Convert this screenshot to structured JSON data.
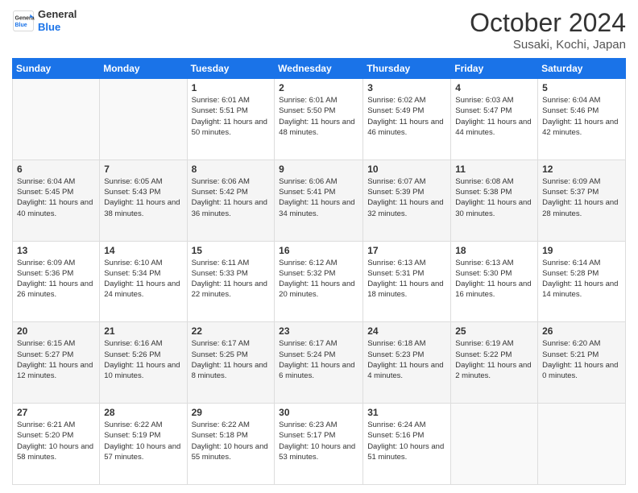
{
  "header": {
    "logo_line1": "General",
    "logo_line2": "Blue",
    "month": "October 2024",
    "location": "Susaki, Kochi, Japan"
  },
  "days_of_week": [
    "Sunday",
    "Monday",
    "Tuesday",
    "Wednesday",
    "Thursday",
    "Friday",
    "Saturday"
  ],
  "weeks": [
    [
      {
        "day": "",
        "sunrise": "",
        "sunset": "",
        "daylight": ""
      },
      {
        "day": "",
        "sunrise": "",
        "sunset": "",
        "daylight": ""
      },
      {
        "day": "1",
        "sunrise": "Sunrise: 6:01 AM",
        "sunset": "Sunset: 5:51 PM",
        "daylight": "Daylight: 11 hours and 50 minutes."
      },
      {
        "day": "2",
        "sunrise": "Sunrise: 6:01 AM",
        "sunset": "Sunset: 5:50 PM",
        "daylight": "Daylight: 11 hours and 48 minutes."
      },
      {
        "day": "3",
        "sunrise": "Sunrise: 6:02 AM",
        "sunset": "Sunset: 5:49 PM",
        "daylight": "Daylight: 11 hours and 46 minutes."
      },
      {
        "day": "4",
        "sunrise": "Sunrise: 6:03 AM",
        "sunset": "Sunset: 5:47 PM",
        "daylight": "Daylight: 11 hours and 44 minutes."
      },
      {
        "day": "5",
        "sunrise": "Sunrise: 6:04 AM",
        "sunset": "Sunset: 5:46 PM",
        "daylight": "Daylight: 11 hours and 42 minutes."
      }
    ],
    [
      {
        "day": "6",
        "sunrise": "Sunrise: 6:04 AM",
        "sunset": "Sunset: 5:45 PM",
        "daylight": "Daylight: 11 hours and 40 minutes."
      },
      {
        "day": "7",
        "sunrise": "Sunrise: 6:05 AM",
        "sunset": "Sunset: 5:43 PM",
        "daylight": "Daylight: 11 hours and 38 minutes."
      },
      {
        "day": "8",
        "sunrise": "Sunrise: 6:06 AM",
        "sunset": "Sunset: 5:42 PM",
        "daylight": "Daylight: 11 hours and 36 minutes."
      },
      {
        "day": "9",
        "sunrise": "Sunrise: 6:06 AM",
        "sunset": "Sunset: 5:41 PM",
        "daylight": "Daylight: 11 hours and 34 minutes."
      },
      {
        "day": "10",
        "sunrise": "Sunrise: 6:07 AM",
        "sunset": "Sunset: 5:39 PM",
        "daylight": "Daylight: 11 hours and 32 minutes."
      },
      {
        "day": "11",
        "sunrise": "Sunrise: 6:08 AM",
        "sunset": "Sunset: 5:38 PM",
        "daylight": "Daylight: 11 hours and 30 minutes."
      },
      {
        "day": "12",
        "sunrise": "Sunrise: 6:09 AM",
        "sunset": "Sunset: 5:37 PM",
        "daylight": "Daylight: 11 hours and 28 minutes."
      }
    ],
    [
      {
        "day": "13",
        "sunrise": "Sunrise: 6:09 AM",
        "sunset": "Sunset: 5:36 PM",
        "daylight": "Daylight: 11 hours and 26 minutes."
      },
      {
        "day": "14",
        "sunrise": "Sunrise: 6:10 AM",
        "sunset": "Sunset: 5:34 PM",
        "daylight": "Daylight: 11 hours and 24 minutes."
      },
      {
        "day": "15",
        "sunrise": "Sunrise: 6:11 AM",
        "sunset": "Sunset: 5:33 PM",
        "daylight": "Daylight: 11 hours and 22 minutes."
      },
      {
        "day": "16",
        "sunrise": "Sunrise: 6:12 AM",
        "sunset": "Sunset: 5:32 PM",
        "daylight": "Daylight: 11 hours and 20 minutes."
      },
      {
        "day": "17",
        "sunrise": "Sunrise: 6:13 AM",
        "sunset": "Sunset: 5:31 PM",
        "daylight": "Daylight: 11 hours and 18 minutes."
      },
      {
        "day": "18",
        "sunrise": "Sunrise: 6:13 AM",
        "sunset": "Sunset: 5:30 PM",
        "daylight": "Daylight: 11 hours and 16 minutes."
      },
      {
        "day": "19",
        "sunrise": "Sunrise: 6:14 AM",
        "sunset": "Sunset: 5:28 PM",
        "daylight": "Daylight: 11 hours and 14 minutes."
      }
    ],
    [
      {
        "day": "20",
        "sunrise": "Sunrise: 6:15 AM",
        "sunset": "Sunset: 5:27 PM",
        "daylight": "Daylight: 11 hours and 12 minutes."
      },
      {
        "day": "21",
        "sunrise": "Sunrise: 6:16 AM",
        "sunset": "Sunset: 5:26 PM",
        "daylight": "Daylight: 11 hours and 10 minutes."
      },
      {
        "day": "22",
        "sunrise": "Sunrise: 6:17 AM",
        "sunset": "Sunset: 5:25 PM",
        "daylight": "Daylight: 11 hours and 8 minutes."
      },
      {
        "day": "23",
        "sunrise": "Sunrise: 6:17 AM",
        "sunset": "Sunset: 5:24 PM",
        "daylight": "Daylight: 11 hours and 6 minutes."
      },
      {
        "day": "24",
        "sunrise": "Sunrise: 6:18 AM",
        "sunset": "Sunset: 5:23 PM",
        "daylight": "Daylight: 11 hours and 4 minutes."
      },
      {
        "day": "25",
        "sunrise": "Sunrise: 6:19 AM",
        "sunset": "Sunset: 5:22 PM",
        "daylight": "Daylight: 11 hours and 2 minutes."
      },
      {
        "day": "26",
        "sunrise": "Sunrise: 6:20 AM",
        "sunset": "Sunset: 5:21 PM",
        "daylight": "Daylight: 11 hours and 0 minutes."
      }
    ],
    [
      {
        "day": "27",
        "sunrise": "Sunrise: 6:21 AM",
        "sunset": "Sunset: 5:20 PM",
        "daylight": "Daylight: 10 hours and 58 minutes."
      },
      {
        "day": "28",
        "sunrise": "Sunrise: 6:22 AM",
        "sunset": "Sunset: 5:19 PM",
        "daylight": "Daylight: 10 hours and 57 minutes."
      },
      {
        "day": "29",
        "sunrise": "Sunrise: 6:22 AM",
        "sunset": "Sunset: 5:18 PM",
        "daylight": "Daylight: 10 hours and 55 minutes."
      },
      {
        "day": "30",
        "sunrise": "Sunrise: 6:23 AM",
        "sunset": "Sunset: 5:17 PM",
        "daylight": "Daylight: 10 hours and 53 minutes."
      },
      {
        "day": "31",
        "sunrise": "Sunrise: 6:24 AM",
        "sunset": "Sunset: 5:16 PM",
        "daylight": "Daylight: 10 hours and 51 minutes."
      },
      {
        "day": "",
        "sunrise": "",
        "sunset": "",
        "daylight": ""
      },
      {
        "day": "",
        "sunrise": "",
        "sunset": "",
        "daylight": ""
      }
    ]
  ]
}
